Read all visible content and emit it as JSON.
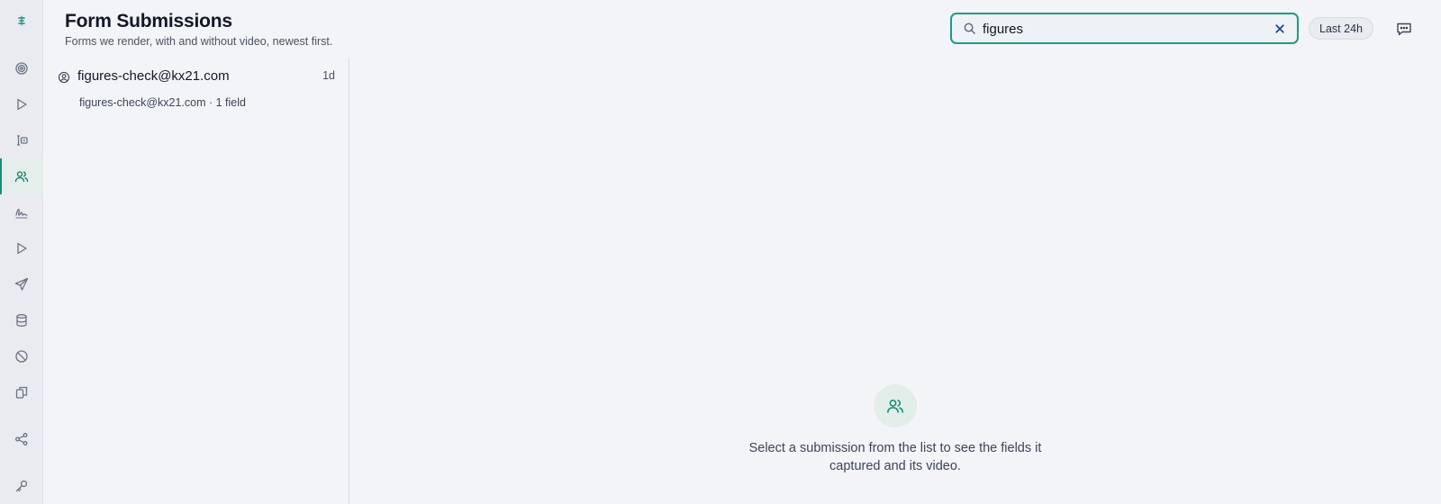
{
  "header": {
    "title": "Form Submissions",
    "subtitle": "Forms we render, with and without video, newest first."
  },
  "search": {
    "value": "figures",
    "icon": "search-icon",
    "clear_icon": "close-icon"
  },
  "filters": {
    "range_label": "Last 24h"
  },
  "sidebar": {
    "active_index": 3,
    "items": [
      {
        "icon": "logo-icon"
      },
      {
        "icon": "target-icon"
      },
      {
        "icon": "play-icon"
      },
      {
        "icon": "form-icon"
      },
      {
        "icon": "users-icon"
      },
      {
        "icon": "signature-icon"
      },
      {
        "icon": "play-icon"
      },
      {
        "icon": "send-icon"
      },
      {
        "icon": "database-icon"
      },
      {
        "icon": "block-icon"
      },
      {
        "icon": "copy-icon"
      },
      {
        "icon": "share-icon"
      },
      {
        "icon": "key-icon"
      }
    ]
  },
  "submissions": [
    {
      "title": "figures-check@kx21.com",
      "age": "1d",
      "meta": "figures-check@kx21.com · 1 field"
    }
  ],
  "empty_state": {
    "message": "Select a submission from the list to see the fields it captured and its video."
  },
  "colors": {
    "accent": "#1a8f75",
    "background": "#f3f4f8",
    "rail": "#e9ebf0"
  }
}
